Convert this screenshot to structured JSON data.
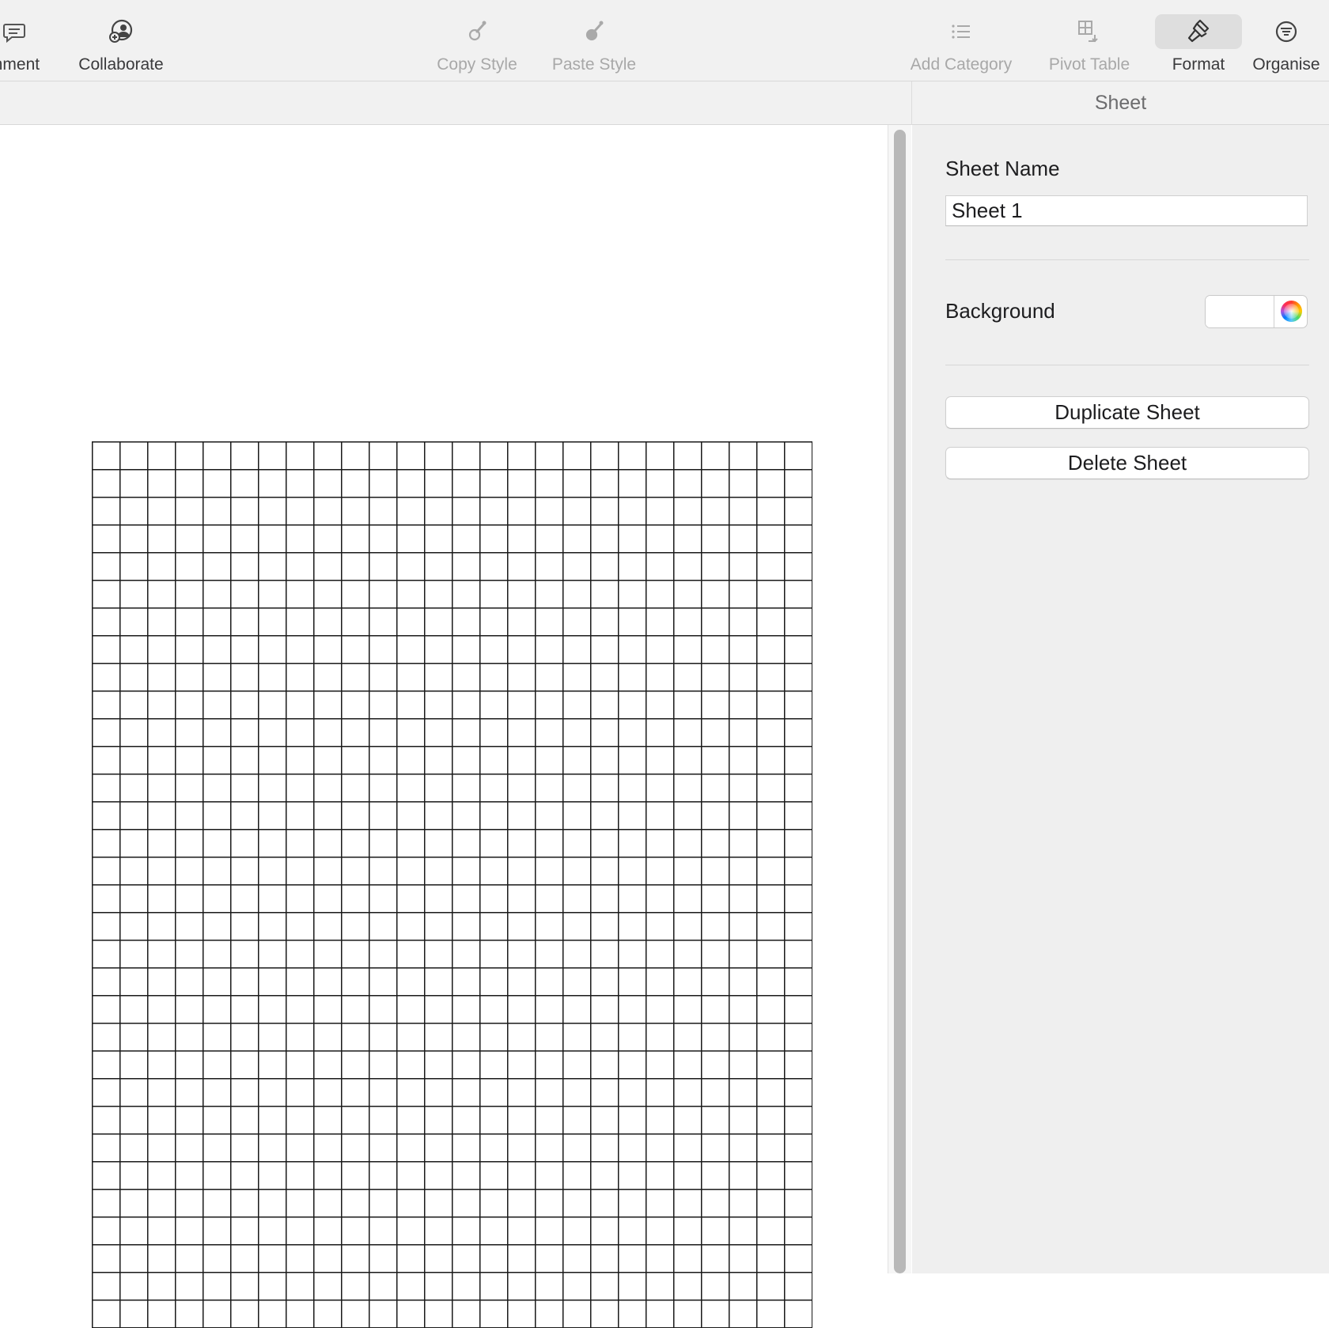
{
  "toolbar": {
    "items": [
      {
        "label": "mment",
        "icon": "comment-icon",
        "state": "enabled"
      },
      {
        "label": "Collaborate",
        "icon": "collaborate-icon",
        "state": "enabled"
      },
      {
        "label": "Copy Style",
        "icon": "copy-style-icon",
        "state": "disabled"
      },
      {
        "label": "Paste Style",
        "icon": "paste-style-icon",
        "state": "disabled"
      },
      {
        "label": "Add Category",
        "icon": "add-category-icon",
        "state": "disabled"
      },
      {
        "label": "Pivot Table",
        "icon": "pivot-table-icon",
        "state": "disabled"
      },
      {
        "label": "Format",
        "icon": "format-brush-icon",
        "state": "selected"
      },
      {
        "label": "Organise",
        "icon": "organise-icon",
        "state": "enabled"
      }
    ]
  },
  "inspector": {
    "tab": "Sheet",
    "sheet_name_label": "Sheet Name",
    "sheet_name_value": "Sheet 1",
    "background_label": "Background",
    "background_color": "#ffffff",
    "duplicate_button": "Duplicate Sheet",
    "delete_button": "Delete Sheet"
  },
  "canvas": {
    "grid": {
      "columns": 26,
      "rows": 32,
      "line_color": "#1a1a1a"
    }
  },
  "colors": {
    "toolbar_bg": "#f1f1f1",
    "inspector_bg": "#efefef",
    "disabled_text": "#a8a8a8",
    "selected_item_bg": "#dedede"
  }
}
